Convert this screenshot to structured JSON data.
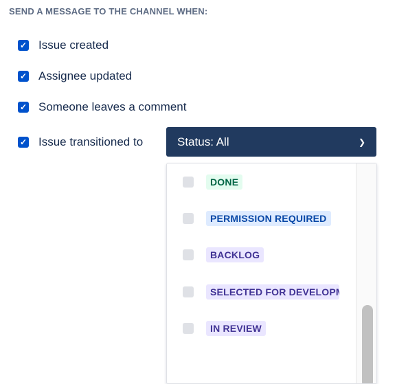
{
  "header": "SEND A MESSAGE TO THE CHANNEL WHEN:",
  "options": [
    {
      "label": "Issue created",
      "checked": true
    },
    {
      "label": "Assignee updated",
      "checked": true
    },
    {
      "label": "Someone leaves a comment",
      "checked": true
    },
    {
      "label": "Issue transitioned to",
      "checked": true
    }
  ],
  "status_select": {
    "label": "Status: All",
    "icon": "chevron-down-icon"
  },
  "statuses": [
    {
      "label": "DONE",
      "bg": "#e3fcef",
      "fg": "#006644"
    },
    {
      "label": "PERMISSION REQUIRED",
      "bg": "#deebff",
      "fg": "#0747a6"
    },
    {
      "label": "BACKLOG",
      "bg": "#eae6ff",
      "fg": "#403294"
    },
    {
      "label": "SELECTED FOR DEVELOPMENT",
      "bg": "#eae6ff",
      "fg": "#403294"
    },
    {
      "label": "IN REVIEW",
      "bg": "#eae6ff",
      "fg": "#403294"
    }
  ]
}
